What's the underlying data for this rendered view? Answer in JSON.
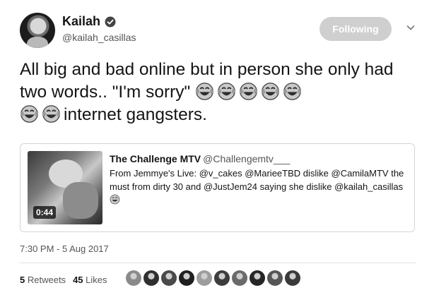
{
  "author": {
    "name": "Kailah",
    "handle": "@kailah_casillas",
    "verified": true
  },
  "follow_button": {
    "label": "Following"
  },
  "tweet": {
    "text_part1": "All big and bad online but in person she only had two words.. \"I'm sorry\"",
    "emoji_name": "face-with-tears-of-joy",
    "text_part2": "internet gangsters."
  },
  "quote": {
    "name": "The Challenge MTV",
    "handle": "@Challengemtv___",
    "text": "From Jemmye's Live: @v_cakes @MarieeTBD dislike @CamilaMTV the must from dirty 30 and @JustJem24 saying she dislike @kailah_casillas",
    "video_duration": "0:44"
  },
  "timestamp": "7:30 PM - 5 Aug 2017",
  "stats": {
    "retweets_count": "5",
    "retweets_label": "Retweets",
    "likes_count": "45",
    "likes_label": "Likes"
  },
  "liker_avatar_count": 10
}
